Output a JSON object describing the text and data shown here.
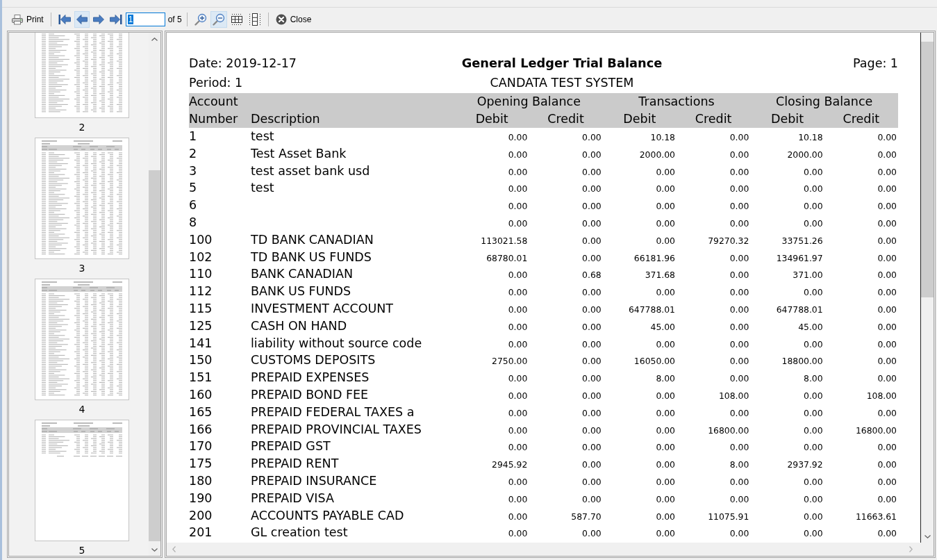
{
  "toolbar": {
    "print_button": {
      "label": "Print"
    },
    "nav_buttons": [
      {
        "highlighted": false
      },
      {
        "highlighted": true
      },
      {
        "highlighted": false
      },
      {
        "highlighted": false
      }
    ],
    "page_field": {
      "value": "1",
      "value_selected": true
    },
    "page_count": "of 5",
    "view_buttons": [
      {
        "highlighted": false
      },
      {
        "highlighted": true
      },
      {
        "highlighted": false
      },
      {
        "highlighted": false
      }
    ],
    "close_button": {
      "label": "Close"
    }
  },
  "thumbnails": [
    {
      "label": "2",
      "kind": "cut_top"
    },
    {
      "label": "3",
      "kind": "full"
    },
    {
      "label": "4",
      "kind": "full"
    },
    {
      "label": "5",
      "kind": "short"
    }
  ],
  "report": {
    "date": "Date: 2019-12-17",
    "title": "General Ledger Trial Balance",
    "page": "Page: 1",
    "period": "Period: 1",
    "subtitle": "CANDATA TEST SYSTEM",
    "column_groups": [
      "Opening Balance",
      "Transactions",
      "Closing Balance"
    ],
    "columns": [
      "Account Number",
      "Description",
      "Debit",
      "Credit",
      "Debit",
      "Credit",
      "Debit",
      "Credit"
    ],
    "rows": [
      {
        "account": "1",
        "description": "test",
        "values": [
          "0.00",
          "0.00",
          "10.18",
          "0.00",
          "10.18",
          "0.00"
        ]
      },
      {
        "account": "2",
        "description": "Test Asset Bank",
        "values": [
          "0.00",
          "0.00",
          "2000.00",
          "0.00",
          "2000.00",
          "0.00"
        ]
      },
      {
        "account": "3",
        "description": "test asset bank usd",
        "values": [
          "0.00",
          "0.00",
          "0.00",
          "0.00",
          "0.00",
          "0.00"
        ]
      },
      {
        "account": "5",
        "description": "test",
        "values": [
          "0.00",
          "0.00",
          "0.00",
          "0.00",
          "0.00",
          "0.00"
        ]
      },
      {
        "account": "6",
        "values": [
          "0.00",
          "0.00",
          "0.00",
          "0.00",
          "0.00",
          "0.00"
        ]
      },
      {
        "account": "8",
        "values": [
          "0.00",
          "0.00",
          "0.00",
          "0.00",
          "0.00",
          "0.00"
        ]
      },
      {
        "account": "100",
        "description": "TD BANK CANADIAN",
        "values": [
          "113021.58",
          "0.00",
          "0.00",
          "79270.32",
          "33751.26",
          "0.00"
        ]
      },
      {
        "account": "102",
        "description": "TD BANK US FUNDS",
        "values": [
          "68780.01",
          "0.00",
          "66181.96",
          "0.00",
          "134961.97",
          "0.00"
        ]
      },
      {
        "account": "110",
        "description": "BANK CANADIAN",
        "values": [
          "0.00",
          "0.68",
          "371.68",
          "0.00",
          "371.00",
          "0.00"
        ]
      },
      {
        "account": "112",
        "description": "BANK US FUNDS",
        "values": [
          "0.00",
          "0.00",
          "0.00",
          "0.00",
          "0.00",
          "0.00"
        ]
      },
      {
        "account": "115",
        "description": "INVESTMENT ACCOUNT",
        "values": [
          "0.00",
          "0.00",
          "647788.01",
          "0.00",
          "647788.01",
          "0.00"
        ]
      },
      {
        "account": "125",
        "description": "CASH ON HAND",
        "values": [
          "0.00",
          "0.00",
          "45.00",
          "0.00",
          "45.00",
          "0.00"
        ]
      },
      {
        "account": "141",
        "description": "liability without source code",
        "values": [
          "0.00",
          "0.00",
          "0.00",
          "0.00",
          "0.00",
          "0.00"
        ]
      },
      {
        "account": "150",
        "description": "CUSTOMS DEPOSITS",
        "values": [
          "2750.00",
          "0.00",
          "16050.00",
          "0.00",
          "18800.00",
          "0.00"
        ]
      },
      {
        "account": "151",
        "description": "PREPAID EXPENSES",
        "values": [
          "0.00",
          "0.00",
          "8.00",
          "0.00",
          "8.00",
          "0.00"
        ]
      },
      {
        "account": "160",
        "description": "PREPAID BOND FEE",
        "values": [
          "0.00",
          "0.00",
          "0.00",
          "108.00",
          "0.00",
          "108.00"
        ]
      },
      {
        "account": "165",
        "description": "PREPAID FEDERAL TAXES a",
        "values": [
          "0.00",
          "0.00",
          "0.00",
          "0.00",
          "0.00",
          "0.00"
        ]
      },
      {
        "account": "166",
        "description": "PREPAID PROVINCIAL TAXES",
        "values": [
          "0.00",
          "0.00",
          "0.00",
          "16800.00",
          "0.00",
          "16800.00"
        ]
      },
      {
        "account": "170",
        "description": "PREPAID GST",
        "values": [
          "0.00",
          "0.00",
          "0.00",
          "0.00",
          "0.00",
          "0.00"
        ]
      },
      {
        "account": "175",
        "description": "PREPAID RENT",
        "values": [
          "2945.92",
          "0.00",
          "0.00",
          "8.00",
          "2937.92",
          "0.00"
        ]
      },
      {
        "account": "180",
        "description": "PREPAID INSURANCE",
        "values": [
          "0.00",
          "0.00",
          "0.00",
          "0.00",
          "0.00",
          "0.00"
        ]
      },
      {
        "account": "190",
        "description": "PREPAID VISA",
        "values": [
          "0.00",
          "0.00",
          "0.00",
          "0.00",
          "0.00",
          "0.00"
        ]
      },
      {
        "account": "200",
        "description": "ACCOUNTS PAYABLE CAD",
        "values": [
          "0.00",
          "587.70",
          "0.00",
          "11075.91",
          "0.00",
          "11663.61"
        ]
      },
      {
        "account": "201",
        "description": "GL creation test",
        "values": [
          "0.00",
          "0.00",
          "0.00",
          "0.00",
          "0.00",
          "0.00"
        ]
      }
    ]
  }
}
